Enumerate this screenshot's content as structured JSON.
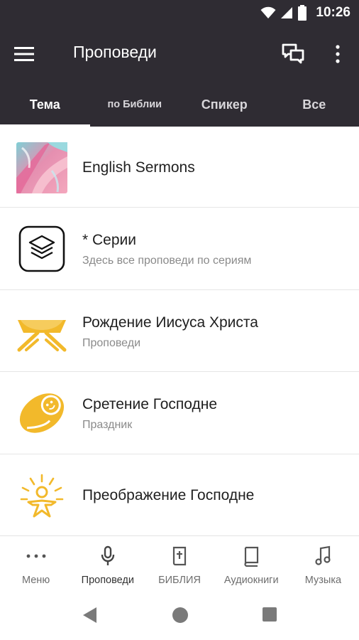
{
  "status_bar": {
    "time": "10:26"
  },
  "app_bar": {
    "title": "Проповеди"
  },
  "tabs": [
    {
      "label": "Тема",
      "active": true
    },
    {
      "label": "по Библии",
      "active": false
    },
    {
      "label": "Спикер",
      "active": false
    },
    {
      "label": "Все",
      "active": false
    }
  ],
  "list": [
    {
      "title": "English Sermons",
      "subtitle": "",
      "icon": "abstract-painting-thumbnail"
    },
    {
      "title": "* Серии",
      "subtitle": "Здесь все проповеди по сериям",
      "icon": "layers-icon"
    },
    {
      "title": "Рождение Иисуса Христа",
      "subtitle": "Проповеди",
      "icon": "manger-icon"
    },
    {
      "title": "Сретение Господне",
      "subtitle": "Праздник",
      "icon": "swaddled-baby-icon"
    },
    {
      "title": "Преображение Господне",
      "subtitle": "",
      "icon": "radiant-figure-icon"
    }
  ],
  "bottom_nav": [
    {
      "label": "Меню",
      "icon": "more-horizontal-icon"
    },
    {
      "label": "Проповеди",
      "icon": "microphone-icon",
      "active": true
    },
    {
      "label": "БИБЛИЯ",
      "icon": "bible-icon"
    },
    {
      "label": "Аудиокниги",
      "icon": "book-icon"
    },
    {
      "label": "Музыка",
      "icon": "music-note-icon"
    }
  ],
  "colors": {
    "app_bar": "#2f2c33",
    "accent_icon": "#f2b92b",
    "text_primary": "#1f1f1f",
    "text_secondary": "#8a8a8a"
  }
}
